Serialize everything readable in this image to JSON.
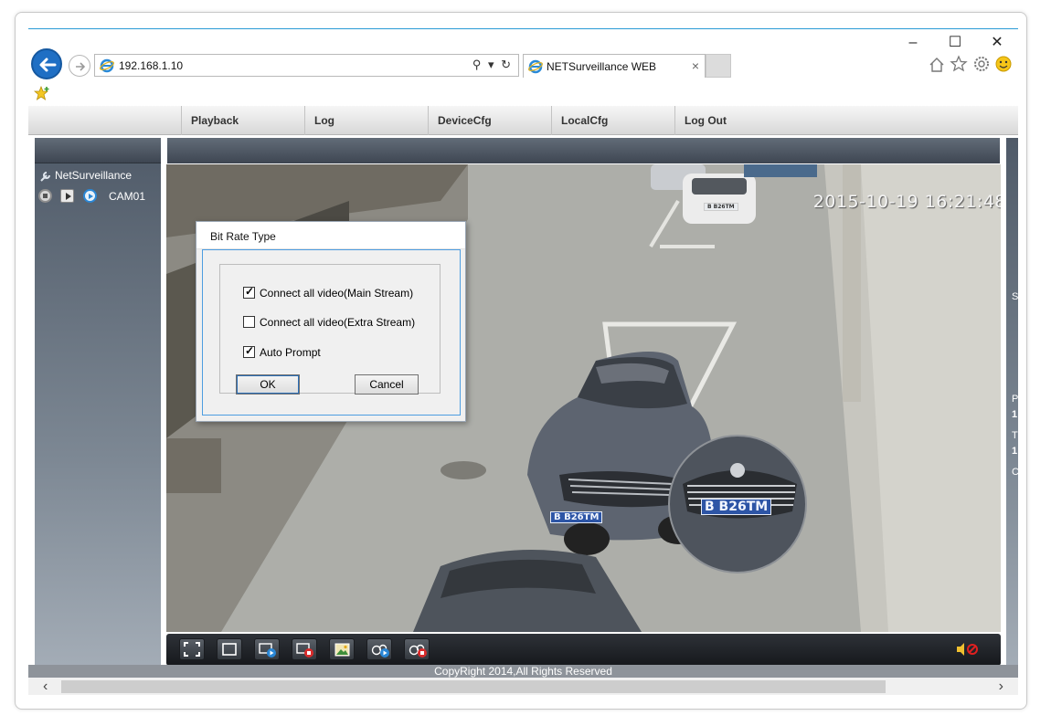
{
  "browser": {
    "url": "192.168.1.10",
    "address_tools": "⚲ ▾ ↻",
    "tab_title": "NETSurveillance WEB",
    "tab_close": "×",
    "minimize": "–",
    "maximize": "☐",
    "close": "✕",
    "toolbar_icons": [
      "home-icon",
      "favorites-star-icon",
      "gear-icon",
      "smiley-icon"
    ]
  },
  "menu": {
    "items": [
      {
        "label": "Playback"
      },
      {
        "label": "Log"
      },
      {
        "label": "DeviceCfg"
      },
      {
        "label": "LocalCfg"
      },
      {
        "label": "Log Out"
      }
    ]
  },
  "sidebar": {
    "root_label": "NetSurveillance",
    "camera_label": "CAM01"
  },
  "video": {
    "timestamp": "2015-10-19 16:21:48",
    "plate_main": "B B26TM",
    "plate_zoom": "B B26TM",
    "plate_far": "B B26TM"
  },
  "right_panel": {
    "letters": [
      "S",
      "P",
      "1",
      "T",
      "1",
      "C"
    ]
  },
  "dialog": {
    "title": "Bit Rate Type",
    "options": [
      {
        "label": "Connect all video(Main Stream)",
        "checked": true
      },
      {
        "label": "Connect all video(Extra Stream)",
        "checked": false
      },
      {
        "label": "Auto Prompt",
        "checked": true
      }
    ],
    "ok_label": "OK",
    "cancel_label": "Cancel",
    "check_mark": "✓"
  },
  "footer": {
    "copyright": "CopyRight 2014,All Rights Reserved"
  },
  "scrollbar": {
    "left_arrow": "‹",
    "right_arrow": "›"
  },
  "colors": {
    "accent": "#2b9bd6",
    "panel_dark": "#3e4652",
    "plate_blue": "#2d55a6"
  }
}
